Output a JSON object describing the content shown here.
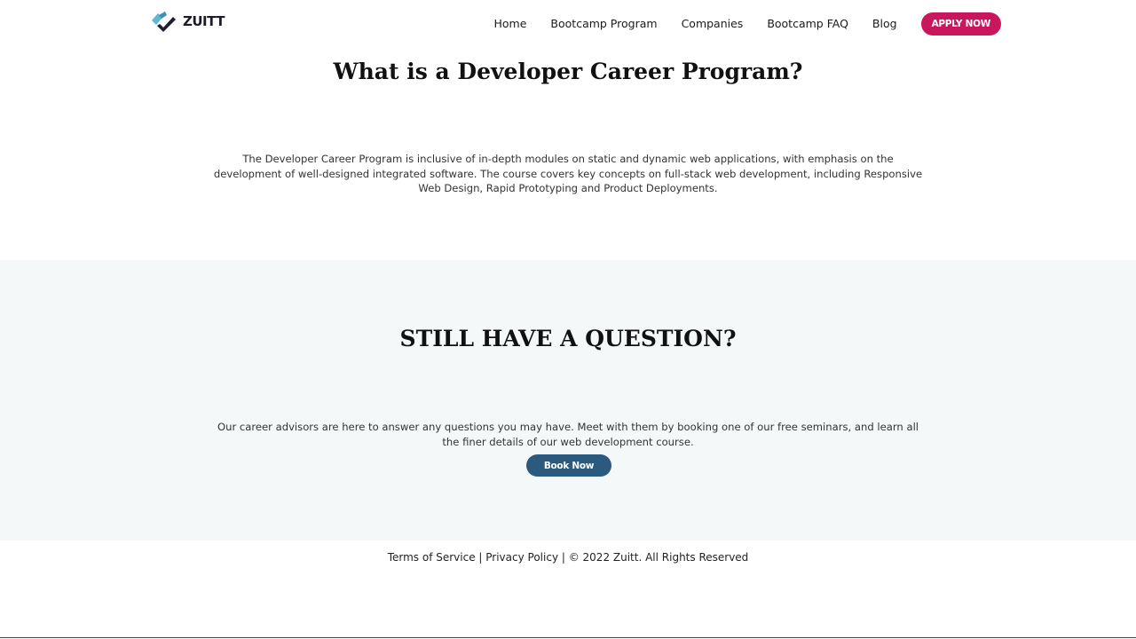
{
  "brand": {
    "name": "ZUITT",
    "accent_color": "#c8175d",
    "secondary_color": "#2b5a7e",
    "logo_icon": "zuitt-logo-icon"
  },
  "nav": {
    "links": [
      {
        "label": "Home"
      },
      {
        "label": "Bootcamp Program"
      },
      {
        "label": "Companies"
      },
      {
        "label": "Bootcamp FAQ"
      },
      {
        "label": "Blog"
      }
    ],
    "cta_label": "APPLY NOW"
  },
  "intro": {
    "heading": "What is a Developer Career Program?",
    "body": "The Developer Career Program is inclusive of in-depth modules on static and dynamic web applications, with emphasis on the development of well-designed integrated software. The course covers key concepts on full-stack web development, including Responsive Web Design, Rapid Prototyping and Product Deployments."
  },
  "question": {
    "heading": "STILL HAVE A QUESTION?",
    "body": "Our career advisors are here to answer any questions you may have. Meet with them by booking one of our free seminars, and learn all the finer details of our web development course.",
    "button_label": "Book Now"
  },
  "footer": {
    "terms_label": "Terms of Service",
    "separator": " | ",
    "privacy_label": "Privacy Policy",
    "copyright": "© 2022 Zuitt. All Rights Reserved"
  }
}
